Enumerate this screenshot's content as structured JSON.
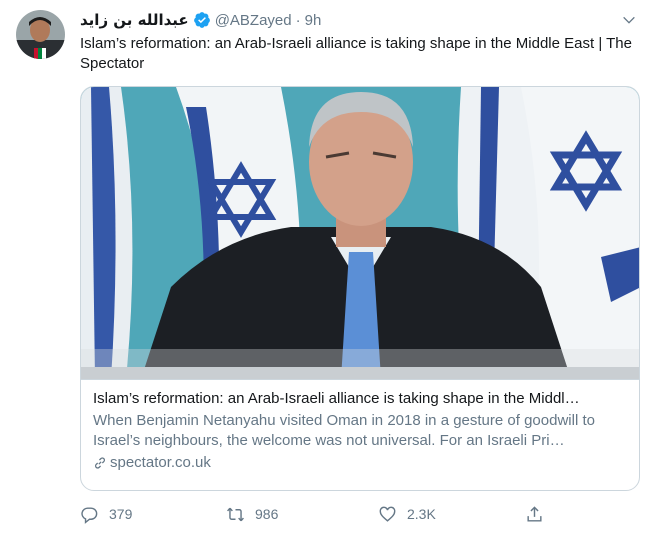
{
  "author": {
    "display_name": "عبدالله بن زايد",
    "handle": "@ABZayed",
    "separator": "·",
    "time": "9h",
    "verified": true
  },
  "tweet": {
    "text": "Islam’s reformation: an Arab-Israeli alliance is taking shape in the Middle East | The Spectator"
  },
  "card": {
    "title": "Islam’s reformation: an Arab-Israeli alliance is taking shape in the Middl…",
    "description": "When Benjamin Netanyahu visited Oman in 2018 in a gesture of goodwill to Israel’s neighbours, the welcome was not universal. For an Israeli Pri…",
    "domain": "spectator.co.uk"
  },
  "actions": {
    "reply_count": "379",
    "retweet_count": "986",
    "like_count": "2.3K"
  },
  "colors": {
    "accent": "#1da1f2",
    "muted_text": "#657786",
    "border": "#ccd6dd"
  },
  "icons": [
    "verified-badge-icon",
    "chevron-down-icon",
    "link-icon",
    "reply-icon",
    "retweet-icon",
    "like-icon",
    "share-icon"
  ]
}
